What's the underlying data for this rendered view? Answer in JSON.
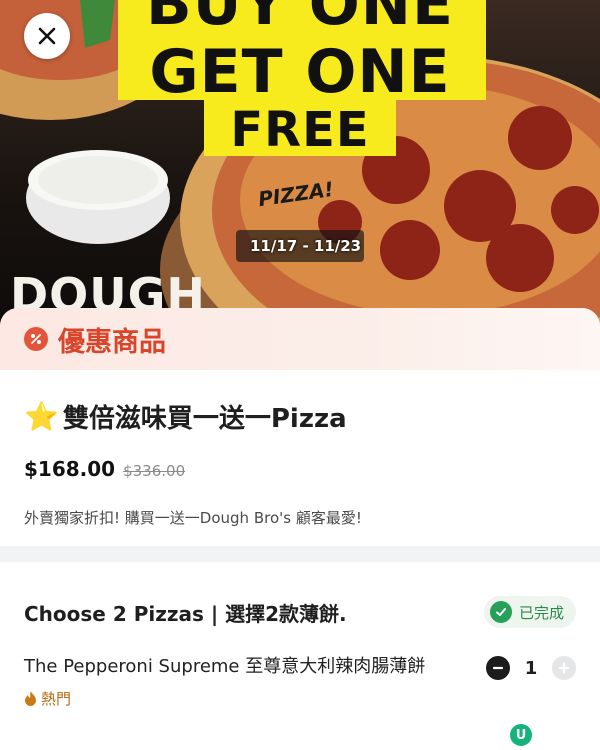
{
  "hero": {
    "banner_line1": "BUY ONE",
    "banner_line2": "GET ONE",
    "banner_line3": "FREE",
    "pizza_tag": "PIZZA!",
    "dates": "11/17 - 11/23",
    "brand": "DOUGH",
    "close_icon": "close-icon"
  },
  "deal": {
    "label": "優惠商品",
    "icon": "percent-badge-icon",
    "color": "#d9452a"
  },
  "product": {
    "star": "⭐",
    "title": "雙倍滋味買一送一Pizza",
    "price": "$168.00",
    "original_price": "$336.00",
    "description": "外賣獨家折扣! 購買一送一Dough Bro's 顧客最愛!"
  },
  "option_group": {
    "title": "Choose 2 Pizzas | 選擇2款薄餅.",
    "status": "已完成",
    "status_color": "#27a05a",
    "items": [
      {
        "name": "The Pepperoni Supreme 至尊意大利辣肉腸薄餅",
        "quantity": "1",
        "tag": "熱門"
      }
    ]
  },
  "colors": {
    "banner_yellow": "#f7ea1d",
    "accent_red": "#e2553a"
  }
}
